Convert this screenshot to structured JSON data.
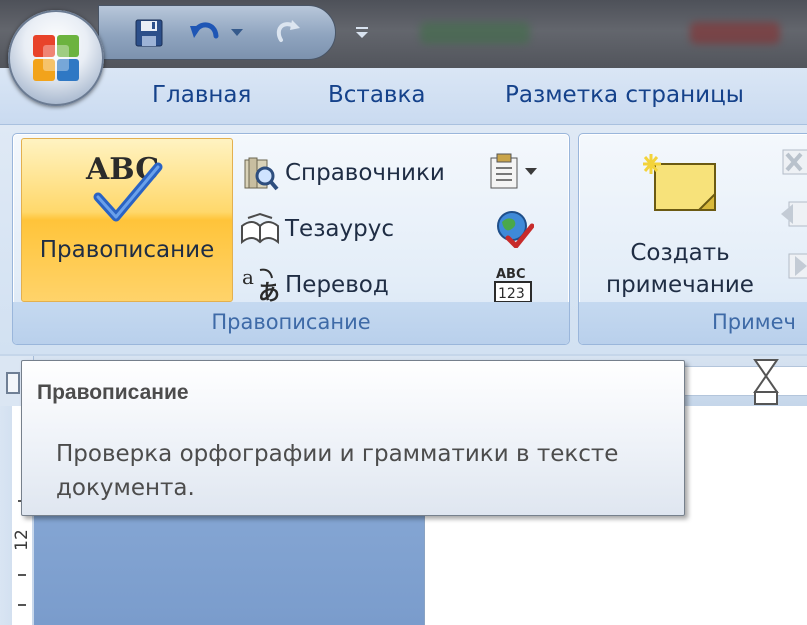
{
  "quick_access": {
    "save_icon": "save-icon",
    "undo_icon": "undo-icon",
    "redo_icon": "redo-icon",
    "customize_icon": "customize-toolbar-icon"
  },
  "office_button": {
    "icon": "office-logo-icon"
  },
  "tabs": [
    {
      "label": "Главная"
    },
    {
      "label": "Вставка"
    },
    {
      "label": "Разметка страницы"
    }
  ],
  "ribbon": {
    "proofing_group": {
      "label": "Правописание",
      "spelling_button": {
        "icon_text": "ABC",
        "label": "Правописание"
      },
      "buttons": [
        {
          "label": "Справочники",
          "icon": "research-icon"
        },
        {
          "label": "Тезаурус",
          "icon": "thesaurus-icon"
        },
        {
          "label": "Перевод",
          "icon": "translate-icon"
        }
      ],
      "icon_buttons": [
        {
          "icon": "translation-tooltip-icon"
        },
        {
          "icon": "set-language-icon"
        },
        {
          "icon": "word-count-icon",
          "text_top": "ABC",
          "text_bottom": "123"
        }
      ]
    },
    "comments_group": {
      "label": "Примеч",
      "new_comment": {
        "line1": "Создать",
        "line2": "примечание"
      }
    }
  },
  "ruler": {
    "vertical_number": "12"
  },
  "tooltip": {
    "title": "Правописание",
    "description": "Проверка орфографии и грамматики в тексте документа."
  },
  "colors": {
    "tab_text": "#15428b",
    "group_label": "#3e6aa7",
    "highlight": "#ffd36a"
  }
}
